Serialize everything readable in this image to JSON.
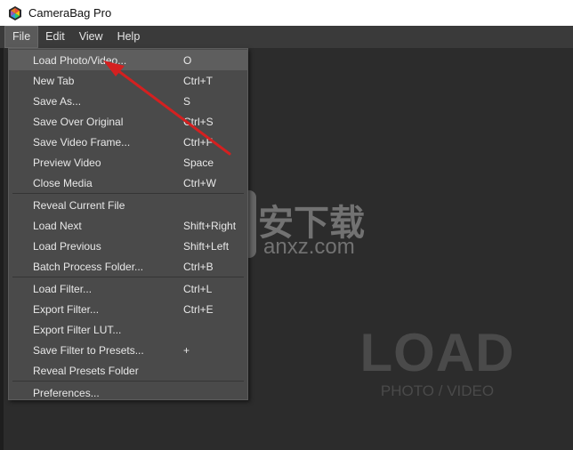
{
  "window": {
    "title": "CameraBag Pro"
  },
  "menubar": {
    "items": [
      "File",
      "Edit",
      "View",
      "Help"
    ]
  },
  "file_menu": {
    "groups": [
      [
        {
          "label": "Load Photo/Video...",
          "shortcut": "O"
        },
        {
          "label": "New Tab",
          "shortcut": "Ctrl+T"
        },
        {
          "label": "Save As...",
          "shortcut": "S"
        },
        {
          "label": "Save Over Original",
          "shortcut": "Ctrl+S"
        },
        {
          "label": "Save Video Frame...",
          "shortcut": "Ctrl+F"
        },
        {
          "label": "Preview Video",
          "shortcut": "Space"
        },
        {
          "label": "Close Media",
          "shortcut": "Ctrl+W"
        }
      ],
      [
        {
          "label": "Reveal Current File",
          "shortcut": ""
        },
        {
          "label": "Load Next",
          "shortcut": "Shift+Right"
        },
        {
          "label": "Load Previous",
          "shortcut": "Shift+Left"
        },
        {
          "label": "Batch Process Folder...",
          "shortcut": "Ctrl+B"
        }
      ],
      [
        {
          "label": "Load Filter...",
          "shortcut": "Ctrl+L"
        },
        {
          "label": "Export Filter...",
          "shortcut": "Ctrl+E"
        },
        {
          "label": "Export Filter LUT...",
          "shortcut": ""
        },
        {
          "label": "Save Filter to Presets...",
          "shortcut": "+"
        },
        {
          "label": "Reveal Presets Folder",
          "shortcut": ""
        }
      ],
      [
        {
          "label": "Preferences...",
          "shortcut": ""
        }
      ]
    ]
  },
  "workspace": {
    "load_title": "LOAD",
    "load_subtitle": "PHOTO / VIDEO"
  },
  "watermark": {
    "cn": "安下载",
    "en": "anxz.com"
  },
  "colors": {
    "annotation_arrow": "#d42020",
    "menu_bg": "#4a4a4a",
    "workspace_bg": "#2c2c2c"
  }
}
